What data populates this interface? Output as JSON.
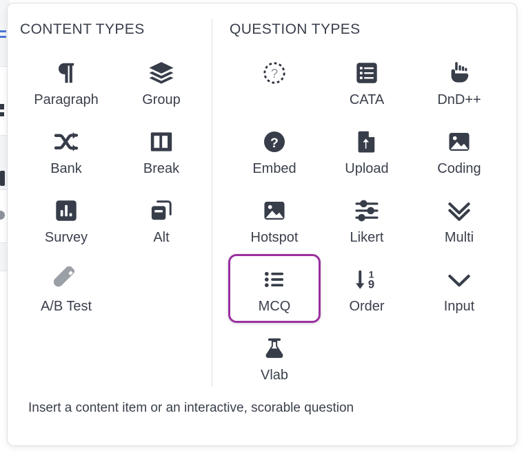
{
  "popup": {
    "footer_note": "Insert a content item or an interactive, scorable question",
    "selected_item": "MCQ",
    "accent_color": "#9b2fa0",
    "icon_color": "#373d49",
    "muted_icon_color": "#9b9fa6"
  },
  "content_types": {
    "title": "CONTENT TYPES",
    "items": [
      {
        "label": "Paragraph",
        "icon": "pilcrow-icon",
        "state": "normal"
      },
      {
        "label": "Group",
        "icon": "layers-icon",
        "state": "normal"
      },
      {
        "label": "Bank",
        "icon": "shuffle-icon",
        "state": "normal"
      },
      {
        "label": "Break",
        "icon": "columns-split-icon",
        "state": "normal"
      },
      {
        "label": "Survey",
        "icon": "bar-chart-icon",
        "state": "normal"
      },
      {
        "label": "Alt",
        "icon": "duplicate-cards-icon",
        "state": "normal"
      },
      {
        "label": "A/B Test",
        "icon": "test-tube-icon",
        "state": "disabled"
      }
    ]
  },
  "question_types": {
    "title": "QUESTION TYPES",
    "items": [
      {
        "label": "",
        "icon": "dashed-question-icon",
        "state": "placeholder"
      },
      {
        "label": "CATA",
        "icon": "checklist-box-icon",
        "state": "normal"
      },
      {
        "label": "DnD++",
        "icon": "pointing-hand-icon",
        "state": "normal"
      },
      {
        "label": "Embed",
        "icon": "question-circle-icon",
        "state": "normal"
      },
      {
        "label": "Upload",
        "icon": "file-upload-icon",
        "state": "normal"
      },
      {
        "label": "Coding",
        "icon": "image-box-icon",
        "state": "normal"
      },
      {
        "label": "Hotspot",
        "icon": "image-box-icon",
        "state": "normal"
      },
      {
        "label": "Likert",
        "icon": "sliders-icon",
        "state": "normal"
      },
      {
        "label": "Multi",
        "icon": "double-check-icon",
        "state": "normal"
      },
      {
        "label": "MCQ",
        "icon": "bulleted-list-icon",
        "state": "selected"
      },
      {
        "label": "Order",
        "icon": "sort-numeric-icon",
        "state": "normal"
      },
      {
        "label": "Input",
        "icon": "check-icon",
        "state": "normal"
      },
      {
        "label": "Vlab",
        "icon": "flask-icon",
        "state": "normal"
      }
    ]
  }
}
